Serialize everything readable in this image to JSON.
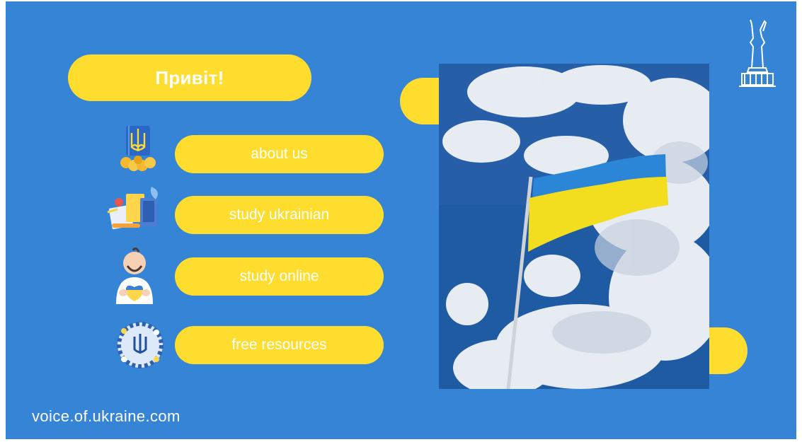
{
  "greeting": "Привіт!",
  "nav": [
    {
      "label": "about us",
      "icon": "trident-coat-of-arms-icon"
    },
    {
      "label": "study ukrainian",
      "icon": "books-study-icon"
    },
    {
      "label": "study online",
      "icon": "cossack-heart-icon"
    },
    {
      "label": "free resources",
      "icon": "floral-wreath-trident-icon"
    }
  ],
  "photo": {
    "subject": "ukrainian-flag-photo"
  },
  "monument_icon": "motherland-monument-icon",
  "footer": "voice.of.ukraine.com",
  "colors": {
    "background": "#3584d6",
    "accent": "#ffdd2e",
    "text": "#ffffff",
    "flag_blue": "#2c86d8",
    "flag_yellow": "#f3dd1f"
  }
}
